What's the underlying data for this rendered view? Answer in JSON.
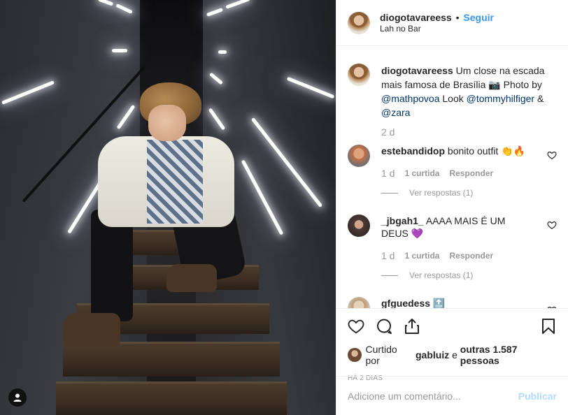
{
  "post": {
    "username": "diogotavareess",
    "follow_label": "Seguir",
    "separator": "•",
    "location": "Lah no Bar"
  },
  "caption": {
    "username": "diogotavareess",
    "text_before": "Um close na escada mais famosa de Brasília 📷 Photo by",
    "mention1": "@mathpovoa",
    "text_mid": "Look",
    "mention2": "@tommyhilfiger",
    "amp": "&",
    "mention3": "@zara",
    "time": "2 d"
  },
  "comments": [
    {
      "username": "estebandidop",
      "text": "bonito outfit 👏🔥",
      "time": "1 d",
      "likes": "1 curtida",
      "reply": "Responder",
      "view_replies": "Ver respostas (1)",
      "avatar_color": "#c0704a"
    },
    {
      "username": "_jbgah1_",
      "text": "AAAA MAIS É UM DEUS 💜",
      "time": "1 d",
      "likes": "1 curtida",
      "reply": "Responder",
      "view_replies": "Ver respostas (1)",
      "avatar_color": "#6a5a52"
    },
    {
      "username": "gfguedess",
      "text": "🔝",
      "avatar_color": "#d8c8b0"
    }
  ],
  "likes": {
    "prefix": "Curtido por",
    "user": "gabluiz",
    "middle": "e",
    "others": "outras 1.587 pessoas"
  },
  "posted_ago": "HÁ 2 DIAS",
  "add_comment": {
    "placeholder": "Adicione um comentário...",
    "publish_label": "Publicar"
  },
  "icons": {
    "like": "heart-icon",
    "comment": "comment-icon",
    "share": "share-icon",
    "save": "bookmark-icon",
    "user_tag": "user-tag-icon"
  },
  "colors": {
    "link": "#3897f0",
    "mention": "#003569",
    "muted": "#999999",
    "publish_disabled": "#b3dbff"
  }
}
